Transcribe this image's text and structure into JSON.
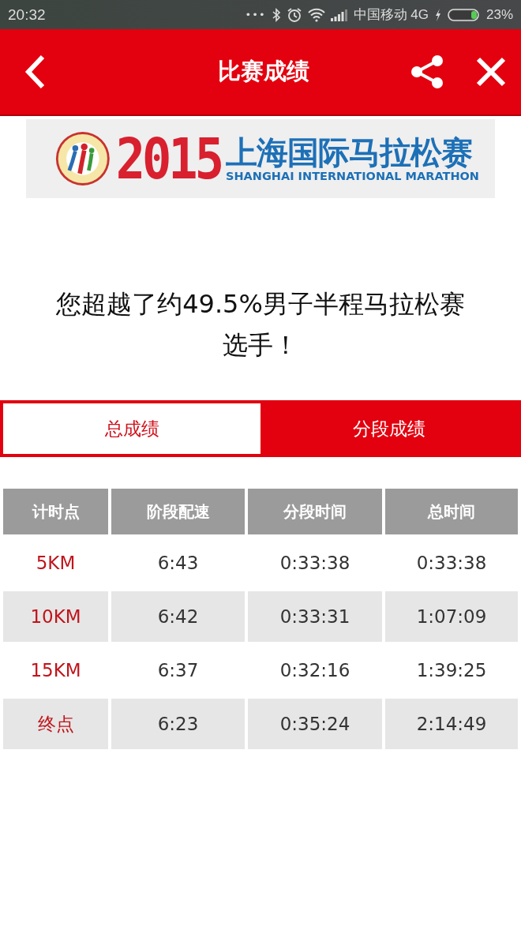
{
  "status_bar": {
    "time": "20:32",
    "dots": "•••",
    "carrier": "中国移动 4G",
    "battery": "23%"
  },
  "header": {
    "title": "比赛成绩"
  },
  "banner": {
    "year": "2015",
    "title": "上海国际马拉松赛",
    "subtitle": "SHANGHAI INTERNATIONAL MARATHON"
  },
  "message": "您超越了约49.5%男子半程马拉松赛选手！",
  "tabs": [
    {
      "label": "总成绩",
      "selected": true
    },
    {
      "label": "分段成绩",
      "selected": false
    }
  ],
  "table": {
    "columns": [
      "计时点",
      "阶段配速",
      "分段时间",
      "总时间"
    ],
    "rows": [
      [
        "5KM",
        "6:43",
        "0:33:38",
        "0:33:38"
      ],
      [
        "10KM",
        "6:42",
        "0:33:31",
        "1:07:09"
      ],
      [
        "15KM",
        "6:37",
        "0:32:16",
        "1:39:25"
      ],
      [
        "终点",
        "6:23",
        "0:35:24",
        "2:14:49"
      ]
    ]
  }
}
